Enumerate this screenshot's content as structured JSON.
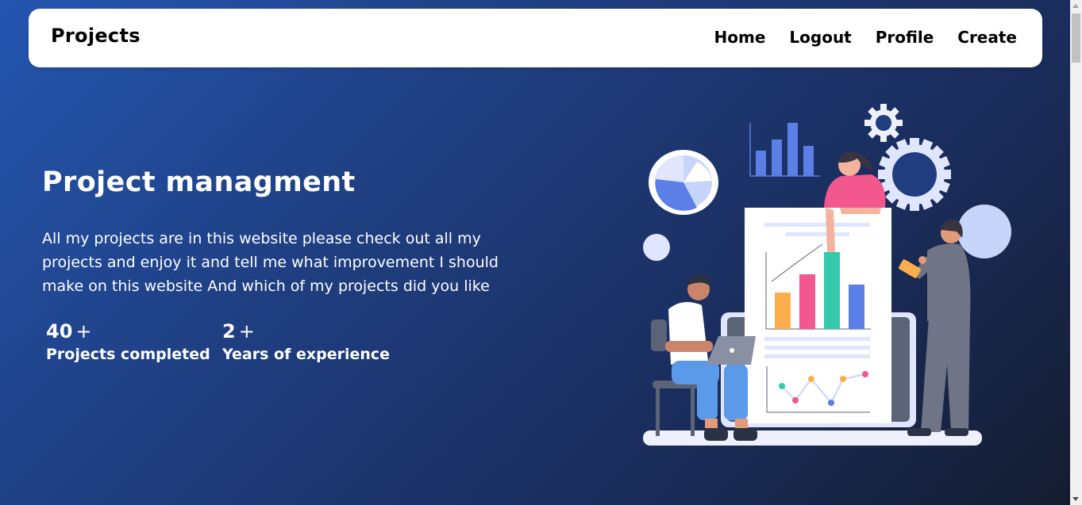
{
  "navbar": {
    "brand": "Projects",
    "links": [
      "Home",
      "Logout",
      "Profile",
      "Create"
    ]
  },
  "hero": {
    "title": "Project managment",
    "description": "All my projects are in this website please check out all my projects and enjoy it and tell me what improvement I should make on this website And which of my projects did you like"
  },
  "stats": [
    {
      "value": "40",
      "suffix": "+",
      "label": "Projects completed"
    },
    {
      "value": "2",
      "suffix": "+",
      "label": "Years of experience"
    }
  ],
  "colors": {
    "accent": "#2456b0",
    "bar_orange": "#fcae4c",
    "bar_pink": "#f2578e",
    "bar_teal": "#35c9ad",
    "bar_blue": "#5b7fe6"
  }
}
